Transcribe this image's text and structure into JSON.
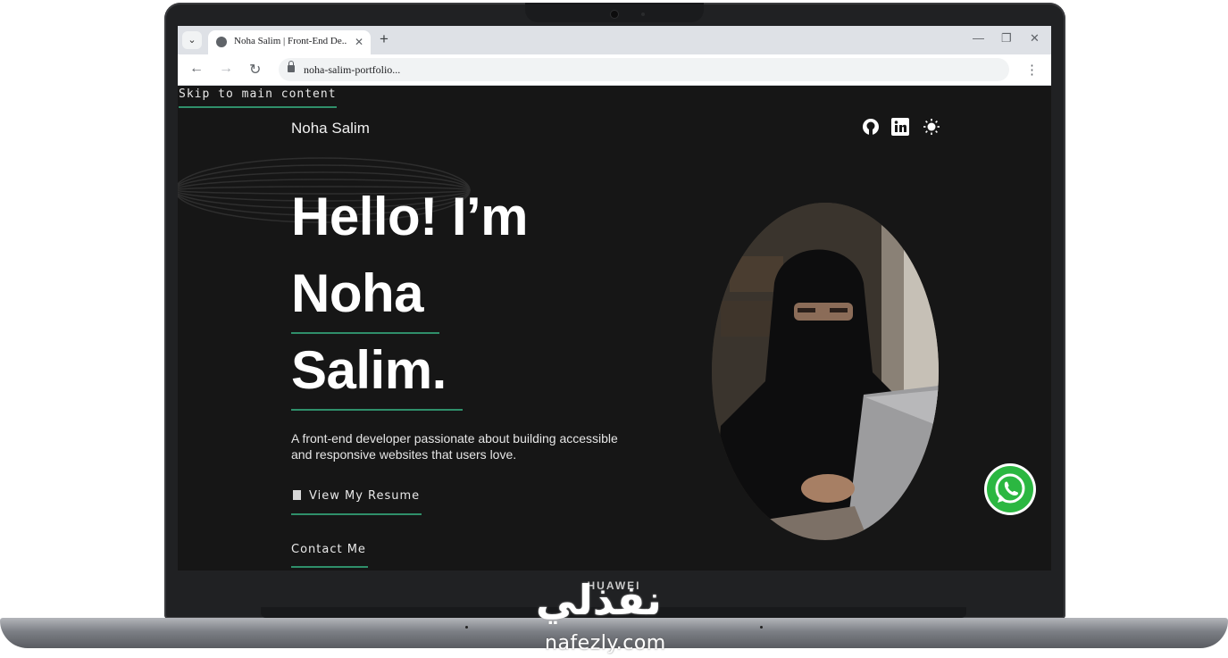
{
  "device": {
    "brand": "HUAWEI"
  },
  "browser": {
    "tab_title": "Noha Salim | Front-End De...",
    "tab_close": "✕",
    "new_tab": "+",
    "url": "noha-salim-portfolio...",
    "back": "←",
    "forward": "→",
    "reload": "↻",
    "menu": "⋮",
    "tab_search": "⌄",
    "win_min": "—",
    "win_restore": "❐",
    "win_close": "✕"
  },
  "page": {
    "skip_link": "Skip to main content",
    "logo": "Noha Salim",
    "social": [
      "github-icon",
      "linkedin-icon",
      "sun-icon"
    ],
    "hero": {
      "line1": "Hello! I’m",
      "line2": "Noha",
      "line3": "Salim."
    },
    "bio": "A front-end developer passionate about building accessible and responsive websites that users love.",
    "resume_label": "View My Resume",
    "contact_label": "Contact Me"
  },
  "watermark": {
    "arabic": "نفذلي",
    "site": "nafezly.com"
  },
  "colors": {
    "accent": "#2f8f6a",
    "page_bg": "#161616",
    "whatsapp": "#2bb741"
  }
}
